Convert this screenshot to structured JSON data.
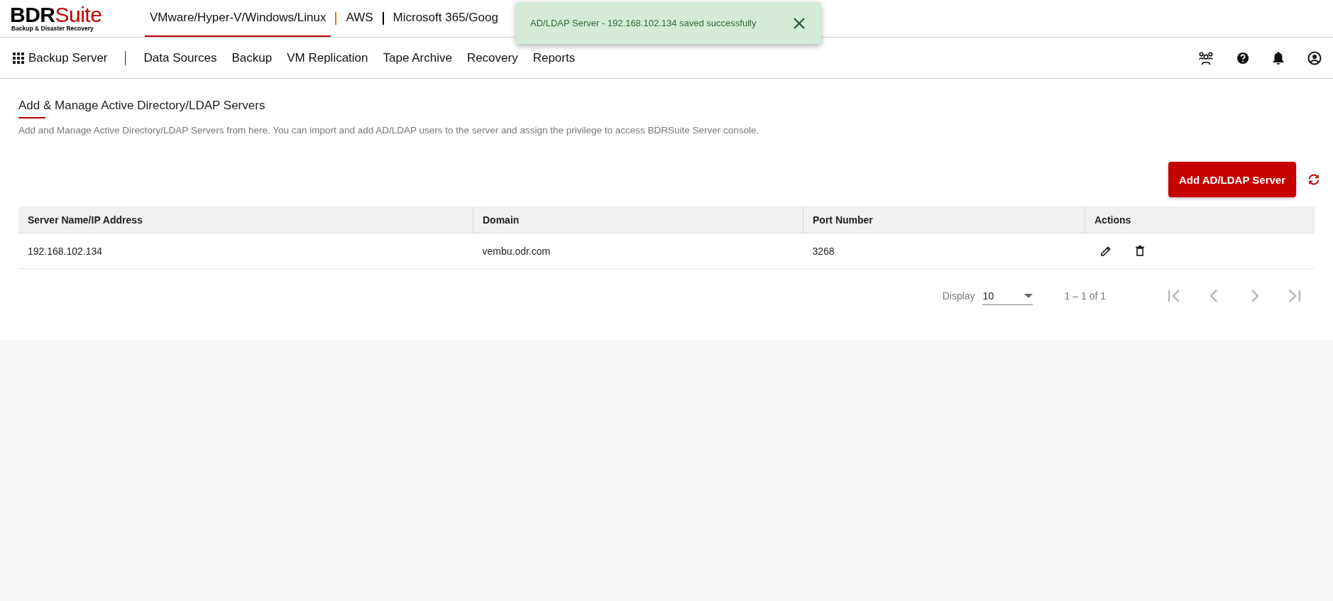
{
  "logo": {
    "brand_dark": "BDR",
    "brand_red": "Suite",
    "tagline": "Backup & Disaster Recovery"
  },
  "product_tabs": [
    {
      "label": "VMware/Hyper-V/Windows/Linux",
      "selected": true
    },
    {
      "label": "AWS",
      "selected": false
    },
    {
      "label": "Microsoft 365/Goog",
      "selected": false
    }
  ],
  "toast": {
    "message": "AD/LDAP Server - 192.168.102.134 saved successfully"
  },
  "nav": {
    "app_label": "Backup Server",
    "items": [
      "Data Sources",
      "Backup",
      "VM Replication",
      "Tape Archive",
      "Recovery",
      "Reports"
    ]
  },
  "page": {
    "title": "Add & Manage Active Directory/LDAP Servers",
    "description": "Add and Manage Active Directory/LDAP Servers from here. You can import and add AD/LDAP users to the server and assign the privilege to access BDRSuite Server console.",
    "add_button": "Add AD/LDAP Server"
  },
  "table": {
    "columns": [
      "Server Name/IP Address",
      "Domain",
      "Port Number",
      "Actions"
    ],
    "rows": [
      {
        "server": "192.168.102.134",
        "domain": "vembu.odr.com",
        "port": "3268"
      }
    ]
  },
  "pagination": {
    "display_label": "Display",
    "page_size": "10",
    "range": "1 – 1 of 1",
    "buttons": [
      {
        "kind": "first",
        "disabled": true
      },
      {
        "kind": "prev",
        "disabled": true
      },
      {
        "kind": "next",
        "disabled": true
      },
      {
        "kind": "last",
        "disabled": true
      }
    ]
  }
}
